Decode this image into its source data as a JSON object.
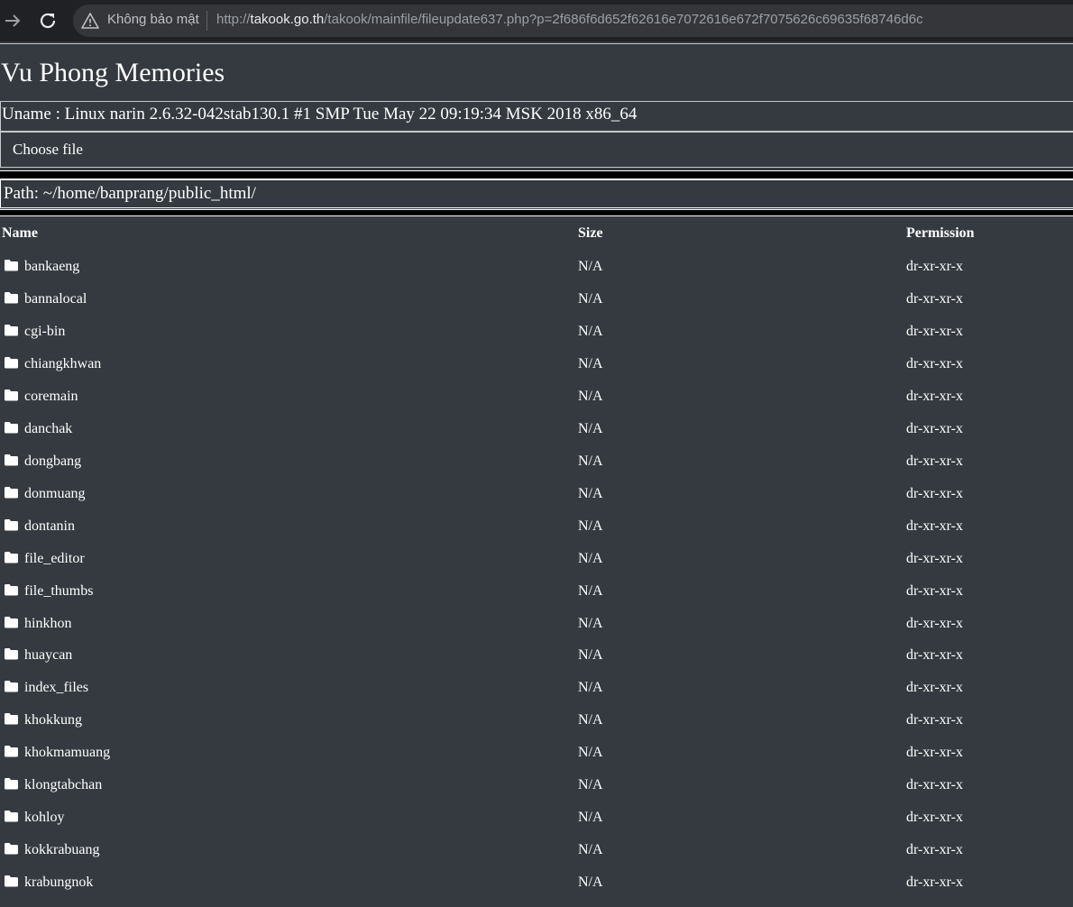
{
  "browser": {
    "security_label": "Không bảo mật",
    "url_scheme": "http://",
    "url_host": "takook.go.th",
    "url_path": "/takook/mainfile/fileupdate637.php?p=2f686f6d652f62616e7072616e672f7075626c69635f68746d6c"
  },
  "page": {
    "title": "Vu Phong Memories",
    "uname": "Uname : Linux narin 2.6.32-042stab130.1 #1 SMP Tue May 22 09:19:34 MSK 2018 x86_64",
    "choose_file_label": "Choose file",
    "path": "Path: ~/home/banprang/public_html/"
  },
  "table": {
    "headers": {
      "name": "Name",
      "size": "Size",
      "permission": "Permission"
    },
    "rows": [
      {
        "name": "bankaeng",
        "size": "N/A",
        "permission": "dr-xr-xr-x"
      },
      {
        "name": "bannalocal",
        "size": "N/A",
        "permission": "dr-xr-xr-x"
      },
      {
        "name": "cgi-bin",
        "size": "N/A",
        "permission": "dr-xr-xr-x"
      },
      {
        "name": "chiangkhwan",
        "size": "N/A",
        "permission": "dr-xr-xr-x"
      },
      {
        "name": "coremain",
        "size": "N/A",
        "permission": "dr-xr-xr-x"
      },
      {
        "name": "danchak",
        "size": "N/A",
        "permission": "dr-xr-xr-x"
      },
      {
        "name": "dongbang",
        "size": "N/A",
        "permission": "dr-xr-xr-x"
      },
      {
        "name": "donmuang",
        "size": "N/A",
        "permission": "dr-xr-xr-x"
      },
      {
        "name": "dontanin",
        "size": "N/A",
        "permission": "dr-xr-xr-x"
      },
      {
        "name": "file_editor",
        "size": "N/A",
        "permission": "dr-xr-xr-x"
      },
      {
        "name": "file_thumbs",
        "size": "N/A",
        "permission": "dr-xr-xr-x"
      },
      {
        "name": "hinkhon",
        "size": "N/A",
        "permission": "dr-xr-xr-x"
      },
      {
        "name": "huaycan",
        "size": "N/A",
        "permission": "dr-xr-xr-x"
      },
      {
        "name": "index_files",
        "size": "N/A",
        "permission": "dr-xr-xr-x"
      },
      {
        "name": "khokkung",
        "size": "N/A",
        "permission": "dr-xr-xr-x"
      },
      {
        "name": "khokmamuang",
        "size": "N/A",
        "permission": "dr-xr-xr-x"
      },
      {
        "name": "klongtabchan",
        "size": "N/A",
        "permission": "dr-xr-xr-x"
      },
      {
        "name": "kohloy",
        "size": "N/A",
        "permission": "dr-xr-xr-x"
      },
      {
        "name": "kokkrabuang",
        "size": "N/A",
        "permission": "dr-xr-xr-x"
      },
      {
        "name": "krabungnok",
        "size": "N/A",
        "permission": "dr-xr-xr-x"
      }
    ]
  }
}
